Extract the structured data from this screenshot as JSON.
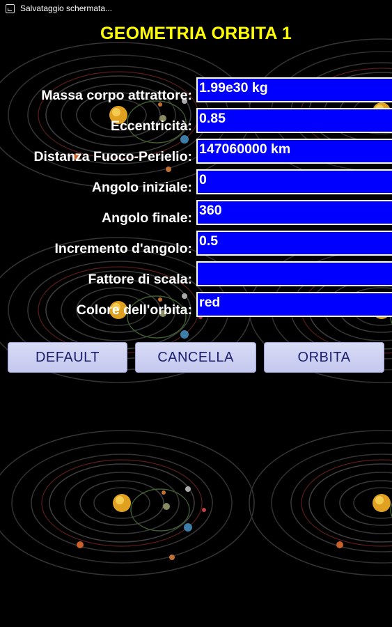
{
  "status_bar": {
    "notification_icon": "screenshot-icon",
    "notification_text": "Salvataggio schermata..."
  },
  "title": "GEOMETRIA ORBITA 1",
  "form": {
    "fields": [
      {
        "label": "Massa corpo attrattore:",
        "value": "1.99e30 kg"
      },
      {
        "label": "Eccentricità:",
        "value": "0.85"
      },
      {
        "label": "Distanza Fuoco-Perielio:",
        "value": "147060000 km"
      },
      {
        "label": "Angolo iniziale:",
        "value": "0"
      },
      {
        "label": "Angolo finale:",
        "value": "360"
      },
      {
        "label": "Incremento d'angolo:",
        "value": "0.5"
      },
      {
        "label": "Fattore di scala:",
        "value": ""
      },
      {
        "label": "Colore dell'orbita:",
        "value": "red"
      }
    ]
  },
  "buttons": {
    "default_label": "DEFAULT",
    "cancel_label": "CANCELLA",
    "orbit_label": "ORBITA"
  },
  "colors": {
    "title": "#ffff00",
    "field_background": "#0000ff",
    "button_background": "#d0d4f2",
    "button_text": "#1a1f6e"
  }
}
